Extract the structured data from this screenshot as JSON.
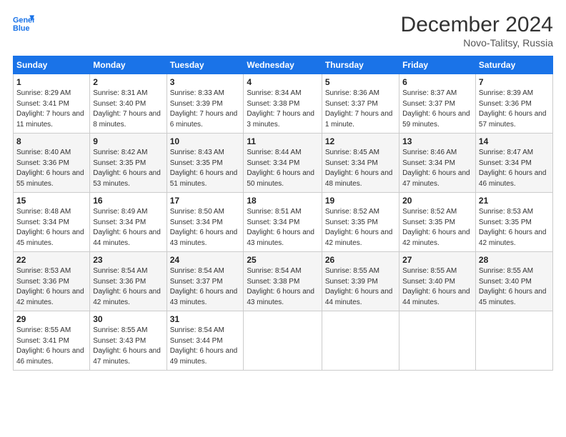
{
  "header": {
    "logo_line1": "General",
    "logo_line2": "Blue",
    "month_title": "December 2024",
    "location": "Novo-Talitsy, Russia"
  },
  "weekdays": [
    "Sunday",
    "Monday",
    "Tuesday",
    "Wednesday",
    "Thursday",
    "Friday",
    "Saturday"
  ],
  "weeks": [
    [
      {
        "day": "1",
        "sunrise": "8:29 AM",
        "sunset": "3:41 PM",
        "daylight": "7 hours and 11 minutes."
      },
      {
        "day": "2",
        "sunrise": "8:31 AM",
        "sunset": "3:40 PM",
        "daylight": "7 hours and 8 minutes."
      },
      {
        "day": "3",
        "sunrise": "8:33 AM",
        "sunset": "3:39 PM",
        "daylight": "7 hours and 6 minutes."
      },
      {
        "day": "4",
        "sunrise": "8:34 AM",
        "sunset": "3:38 PM",
        "daylight": "7 hours and 3 minutes."
      },
      {
        "day": "5",
        "sunrise": "8:36 AM",
        "sunset": "3:37 PM",
        "daylight": "7 hours and 1 minute."
      },
      {
        "day": "6",
        "sunrise": "8:37 AM",
        "sunset": "3:37 PM",
        "daylight": "6 hours and 59 minutes."
      },
      {
        "day": "7",
        "sunrise": "8:39 AM",
        "sunset": "3:36 PM",
        "daylight": "6 hours and 57 minutes."
      }
    ],
    [
      {
        "day": "8",
        "sunrise": "8:40 AM",
        "sunset": "3:36 PM",
        "daylight": "6 hours and 55 minutes."
      },
      {
        "day": "9",
        "sunrise": "8:42 AM",
        "sunset": "3:35 PM",
        "daylight": "6 hours and 53 minutes."
      },
      {
        "day": "10",
        "sunrise": "8:43 AM",
        "sunset": "3:35 PM",
        "daylight": "6 hours and 51 minutes."
      },
      {
        "day": "11",
        "sunrise": "8:44 AM",
        "sunset": "3:34 PM",
        "daylight": "6 hours and 50 minutes."
      },
      {
        "day": "12",
        "sunrise": "8:45 AM",
        "sunset": "3:34 PM",
        "daylight": "6 hours and 48 minutes."
      },
      {
        "day": "13",
        "sunrise": "8:46 AM",
        "sunset": "3:34 PM",
        "daylight": "6 hours and 47 minutes."
      },
      {
        "day": "14",
        "sunrise": "8:47 AM",
        "sunset": "3:34 PM",
        "daylight": "6 hours and 46 minutes."
      }
    ],
    [
      {
        "day": "15",
        "sunrise": "8:48 AM",
        "sunset": "3:34 PM",
        "daylight": "6 hours and 45 minutes."
      },
      {
        "day": "16",
        "sunrise": "8:49 AM",
        "sunset": "3:34 PM",
        "daylight": "6 hours and 44 minutes."
      },
      {
        "day": "17",
        "sunrise": "8:50 AM",
        "sunset": "3:34 PM",
        "daylight": "6 hours and 43 minutes."
      },
      {
        "day": "18",
        "sunrise": "8:51 AM",
        "sunset": "3:34 PM",
        "daylight": "6 hours and 43 minutes."
      },
      {
        "day": "19",
        "sunrise": "8:52 AM",
        "sunset": "3:35 PM",
        "daylight": "6 hours and 42 minutes."
      },
      {
        "day": "20",
        "sunrise": "8:52 AM",
        "sunset": "3:35 PM",
        "daylight": "6 hours and 42 minutes."
      },
      {
        "day": "21",
        "sunrise": "8:53 AM",
        "sunset": "3:35 PM",
        "daylight": "6 hours and 42 minutes."
      }
    ],
    [
      {
        "day": "22",
        "sunrise": "8:53 AM",
        "sunset": "3:36 PM",
        "daylight": "6 hours and 42 minutes."
      },
      {
        "day": "23",
        "sunrise": "8:54 AM",
        "sunset": "3:36 PM",
        "daylight": "6 hours and 42 minutes."
      },
      {
        "day": "24",
        "sunrise": "8:54 AM",
        "sunset": "3:37 PM",
        "daylight": "6 hours and 43 minutes."
      },
      {
        "day": "25",
        "sunrise": "8:54 AM",
        "sunset": "3:38 PM",
        "daylight": "6 hours and 43 minutes."
      },
      {
        "day": "26",
        "sunrise": "8:55 AM",
        "sunset": "3:39 PM",
        "daylight": "6 hours and 44 minutes."
      },
      {
        "day": "27",
        "sunrise": "8:55 AM",
        "sunset": "3:40 PM",
        "daylight": "6 hours and 44 minutes."
      },
      {
        "day": "28",
        "sunrise": "8:55 AM",
        "sunset": "3:40 PM",
        "daylight": "6 hours and 45 minutes."
      }
    ],
    [
      {
        "day": "29",
        "sunrise": "8:55 AM",
        "sunset": "3:41 PM",
        "daylight": "6 hours and 46 minutes."
      },
      {
        "day": "30",
        "sunrise": "8:55 AM",
        "sunset": "3:43 PM",
        "daylight": "6 hours and 47 minutes."
      },
      {
        "day": "31",
        "sunrise": "8:54 AM",
        "sunset": "3:44 PM",
        "daylight": "6 hours and 49 minutes."
      },
      null,
      null,
      null,
      null
    ]
  ]
}
